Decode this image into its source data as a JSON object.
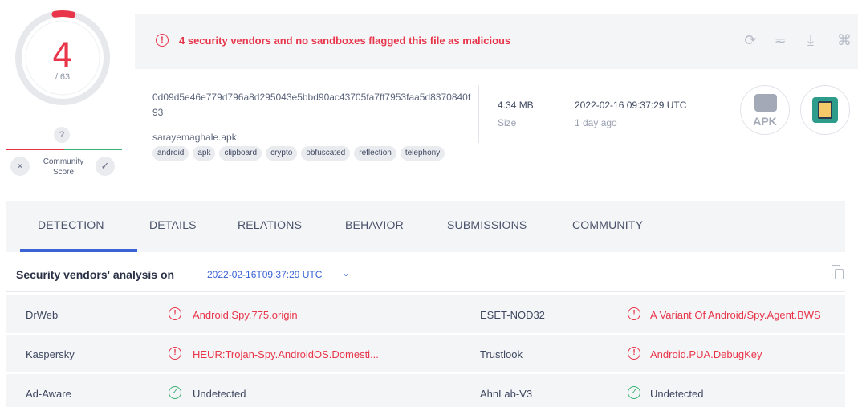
{
  "score": {
    "detections": "4",
    "total": "/ 63",
    "community_badge": "?",
    "community_label_line1": "Community",
    "community_label_line2": "Score",
    "vote_down_glyph": "×",
    "vote_up_glyph": "✓",
    "fraction_flagged": 0.0635
  },
  "alert": {
    "icon": "!",
    "text": "4 security vendors and no sandboxes flagged this file as malicious"
  },
  "toolbar": {
    "reanalyze_icon": "⟳",
    "similar_icon": "≂",
    "download_icon": "⤓",
    "graph_icon": "⌘"
  },
  "file": {
    "hash": "0d09d5e46e779d796a8d295043e5bbd90ac43705fa7ff7953faa5d8370840f93",
    "name": "sarayemaghale.apk",
    "tags": [
      "android",
      "apk",
      "clipboard",
      "crypto",
      "obfuscated",
      "reflection",
      "telephony"
    ],
    "size": "4.34 MB",
    "size_label": "Size",
    "date": "2022-02-16 09:37:29 UTC",
    "date_ago": "1 day ago",
    "type_label": "APK"
  },
  "tabs": [
    "DETECTION",
    "DETAILS",
    "RELATIONS",
    "BEHAVIOR",
    "SUBMISSIONS",
    "COMMUNITY"
  ],
  "analysis": {
    "title": "Security vendors' analysis on",
    "date": "2022-02-16T09:37:29 UTC",
    "chevron": "⌄"
  },
  "vendors": [
    {
      "left": {
        "name": "DrWeb",
        "result": "Android.Spy.775.origin",
        "status": "malicious"
      },
      "right": {
        "name": "ESET-NOD32",
        "result": "A Variant Of Android/Spy.Agent.BWS",
        "status": "malicious"
      }
    },
    {
      "left": {
        "name": "Kaspersky",
        "result": "HEUR:Trojan-Spy.AndroidOS.Domesti...",
        "status": "malicious"
      },
      "right": {
        "name": "Trustlook",
        "result": "Android.PUA.DebugKey",
        "status": "malicious"
      }
    },
    {
      "left": {
        "name": "Ad-Aware",
        "result": "Undetected",
        "status": "clean"
      },
      "right": {
        "name": "AhnLab-V3",
        "result": "Undetected",
        "status": "clean"
      }
    }
  ],
  "colors": {
    "malicious": "#e8354a",
    "clean": "#3bb273",
    "accent": "#3a63d6"
  }
}
